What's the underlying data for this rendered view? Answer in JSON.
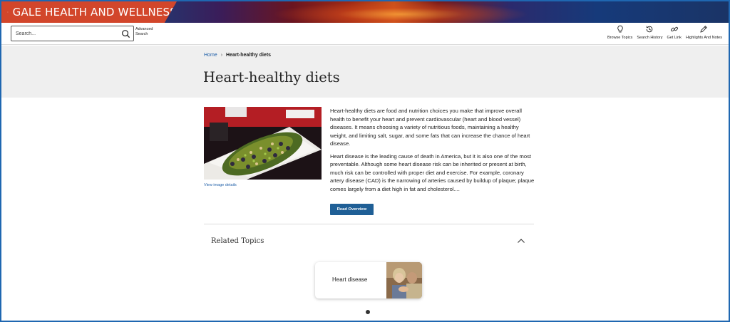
{
  "brand": {
    "title": "GALE HEALTH AND WELLNESS",
    "color": "#d2462b"
  },
  "search": {
    "placeholder": "Search...",
    "value": "",
    "advanced_label": "Advanced Search"
  },
  "tools": [
    {
      "label": "Browse Topics",
      "icon": "lightbulb-icon"
    },
    {
      "label": "Search History",
      "icon": "history-icon"
    },
    {
      "label": "Get Link",
      "icon": "link-icon"
    },
    {
      "label": "Highlights And Notes",
      "icon": "pencil-icon"
    }
  ],
  "breadcrumb": {
    "home": "Home",
    "separator": "›",
    "current": "Heart-healthy diets"
  },
  "page": {
    "title": "Heart-healthy diets"
  },
  "image": {
    "details_link": "View image details"
  },
  "overview": {
    "paragraphs": [
      "Heart-healthy diets are food and nutrition choices you make that improve overall health to benefit your heart and prevent cardiovascular (heart and blood vessel) diseases. It means choosing a variety of nutritious foods, maintaining a healthy weight, and limiting salt, sugar, and some fats that can increase the chance of heart disease.",
      "Heart disease is the leading cause of death in America, but it is also one of the most preventable. Although some heart disease risk can be inherited or present at birth, much risk can be controlled with proper diet and exercise. For example, coronary artery disease (CAD) is the narrowing of arteries caused by buildup of plaque; plaque comes largely from a diet high in fat and cholesterol...."
    ],
    "button_label": "Read Overview",
    "button_color": "#1f5f96"
  },
  "related": {
    "title": "Related Topics",
    "cards": [
      {
        "label": "Heart disease"
      }
    ]
  }
}
